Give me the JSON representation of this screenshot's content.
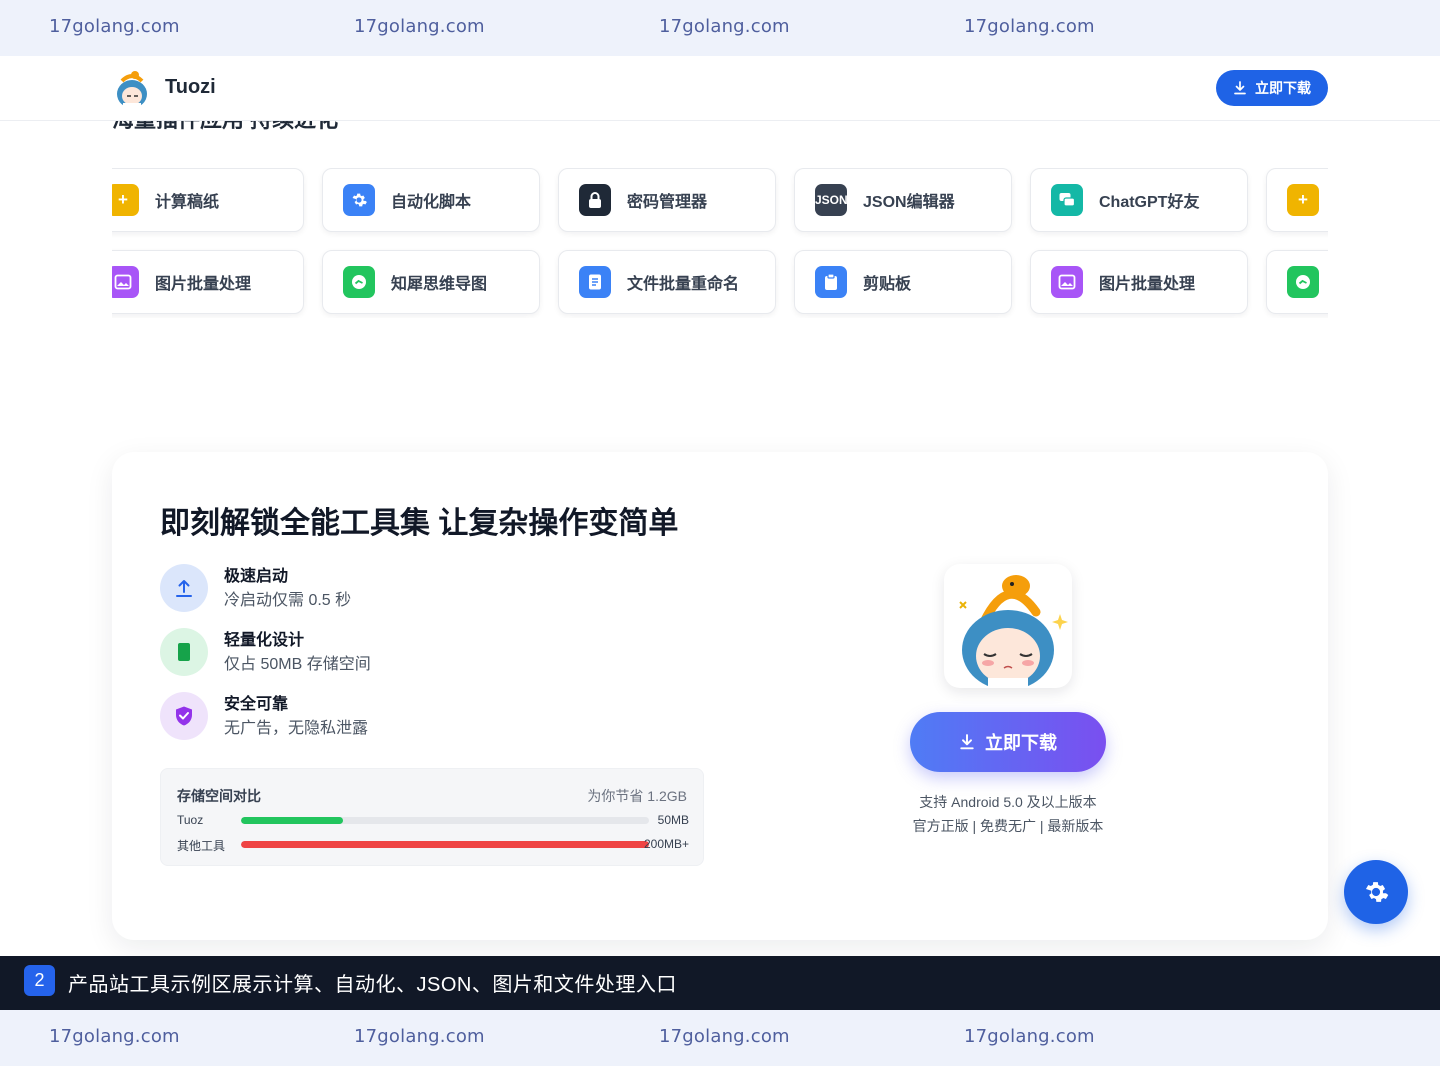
{
  "watermark": {
    "text": "17golang.com"
  },
  "header": {
    "brand": "Tuozi",
    "download_label": "立即下载"
  },
  "tools": {
    "section_title": "海量插件应用 持续进化",
    "row1": [
      {
        "label": "计算稿纸",
        "icon": "plus-icon",
        "color": "#f0b400",
        "glyph": "+"
      },
      {
        "label": "自动化脚本",
        "icon": "gear-icon",
        "color": "#3b82f6",
        "glyph": "⚙"
      },
      {
        "label": "密码管理器",
        "icon": "lock-icon",
        "color": "#1f2937",
        "glyph": ""
      },
      {
        "label": "JSON编辑器",
        "icon": "json-icon",
        "color": "#374151",
        "glyph": "JSON"
      },
      {
        "label": "ChatGPT好友",
        "icon": "chat-icon",
        "color": "#14b8a6",
        "glyph": ""
      },
      {
        "label": "",
        "icon": "plus-icon",
        "color": "#f0b400",
        "glyph": "+"
      }
    ],
    "row2": [
      {
        "label": "图片批量处理",
        "icon": "image-icon",
        "color": "#a855f7",
        "glyph": ""
      },
      {
        "label": "知犀思维导图",
        "icon": "mindmap-icon",
        "color": "#22c55e",
        "glyph": ""
      },
      {
        "label": "文件批量重命名",
        "icon": "file-icon",
        "color": "#3b82f6",
        "glyph": ""
      },
      {
        "label": "剪贴板",
        "icon": "clipboard-icon",
        "color": "#3b82f6",
        "glyph": ""
      },
      {
        "label": "图片批量处理",
        "icon": "image-icon",
        "color": "#a855f7",
        "glyph": ""
      },
      {
        "label": "",
        "icon": "mindmap-icon",
        "color": "#22c55e",
        "glyph": ""
      }
    ]
  },
  "feature": {
    "title": "即刻解锁全能工具集 让复杂操作变简单",
    "items": [
      {
        "title": "极速启动",
        "desc": "冷启动仅需 0.5 秒",
        "icon": "upload-arrow-icon",
        "bg": "#dbe6fb",
        "color": "#2563eb"
      },
      {
        "title": "轻量化设计",
        "desc": "仅占 50MB 存储空间",
        "icon": "battery-icon",
        "bg": "#dcf5e4",
        "color": "#16a34a"
      },
      {
        "title": "安全可靠",
        "desc": "无广告，无隐私泄露",
        "icon": "shield-check-icon",
        "bg": "#efe3fb",
        "color": "#9333ea"
      }
    ],
    "storage": {
      "title": "存储空间对比",
      "saving": "为你节省 1.2GB",
      "rows": [
        {
          "name": "Tuoz",
          "value": "50MB",
          "fraction": 0.25,
          "color": "#22c55e"
        },
        {
          "name": "其他工具",
          "value": "200MB+",
          "fraction": 1.0,
          "color": "#ef4444"
        }
      ]
    },
    "download_label": "立即下载",
    "support_line1": "支持 Android 5.0 及以上版本",
    "support_line2": "官方正版 | 免费无广 | 最新版本"
  },
  "caption": {
    "number": "2",
    "text": "产品站工具示例区展示计算、自动化、JSON、图片和文件处理入口"
  }
}
